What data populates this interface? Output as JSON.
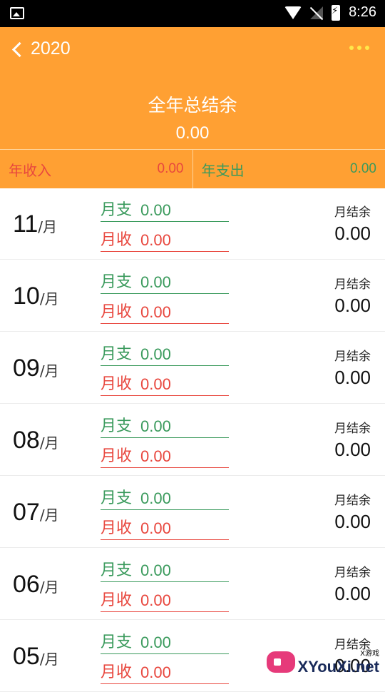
{
  "status": {
    "time": "8:26"
  },
  "header": {
    "year": "2020",
    "total_label": "全年总结余",
    "total_value": "0.00"
  },
  "year_summary": {
    "income_label": "年收入",
    "income_value": "0.00",
    "expense_label": "年支出",
    "expense_value": "0.00"
  },
  "labels": {
    "month_unit": "/月",
    "expense": "月支",
    "income": "月收",
    "balance": "月结余"
  },
  "months": [
    {
      "month": "11",
      "expense": "0.00",
      "income": "0.00",
      "balance": "0.00"
    },
    {
      "month": "10",
      "expense": "0.00",
      "income": "0.00",
      "balance": "0.00"
    },
    {
      "month": "09",
      "expense": "0.00",
      "income": "0.00",
      "balance": "0.00"
    },
    {
      "month": "08",
      "expense": "0.00",
      "income": "0.00",
      "balance": "0.00"
    },
    {
      "month": "07",
      "expense": "0.00",
      "income": "0.00",
      "balance": "0.00"
    },
    {
      "month": "06",
      "expense": "0.00",
      "income": "0.00",
      "balance": "0.00"
    },
    {
      "month": "05",
      "expense": "0.00",
      "income": "0.00",
      "balance": "0.00"
    }
  ],
  "watermark": {
    "small": "X游戏",
    "main": "XYouXi.net"
  },
  "colors": {
    "header": "#FFA033",
    "income": "#E8473E",
    "expense": "#3A9A5C"
  }
}
